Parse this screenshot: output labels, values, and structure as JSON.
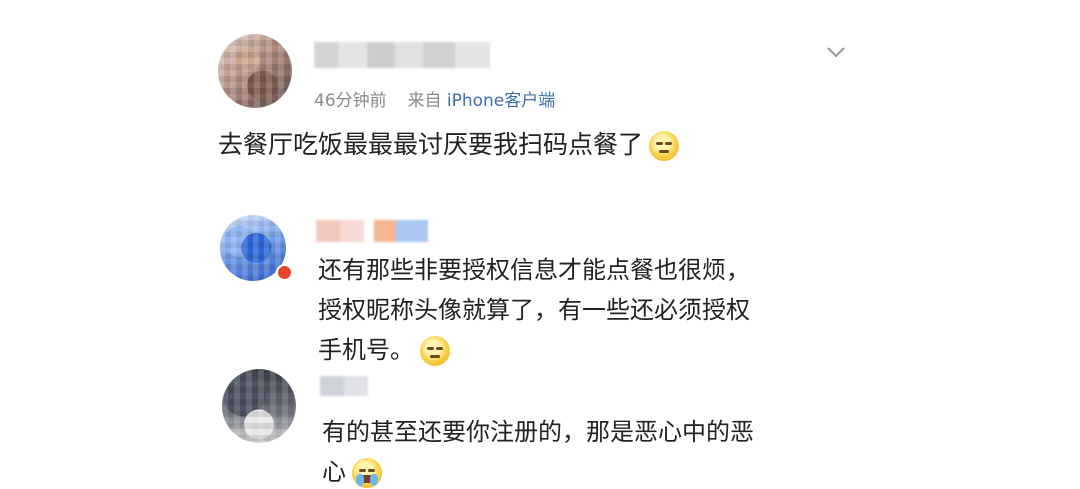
{
  "post": {
    "meta_time": "46分钟前",
    "meta_from": "来自",
    "meta_source": "iPhone客户端",
    "text": "去餐厅吃饭最最最讨厌要我扫码点餐了"
  },
  "comments": [
    {
      "lines": [
        "还有那些非要授权信息才能点餐也很烦，",
        "授权昵称头像就算了，有一些还必须授权",
        "手机号。"
      ]
    },
    {
      "lines": [
        "有的甚至还要你注册的，那是恶心中的恶",
        "心"
      ]
    }
  ],
  "icons": {
    "post_emoji": "awkward-smile-emoji",
    "comment1_emoji": "speechless-emoji",
    "comment2_emoji": "crying-emoji",
    "menu": "chevron-down-icon"
  },
  "colors": {
    "source_link": "#3d6ea8",
    "meta_text": "#8a8a8a",
    "body_text": "#222222"
  }
}
